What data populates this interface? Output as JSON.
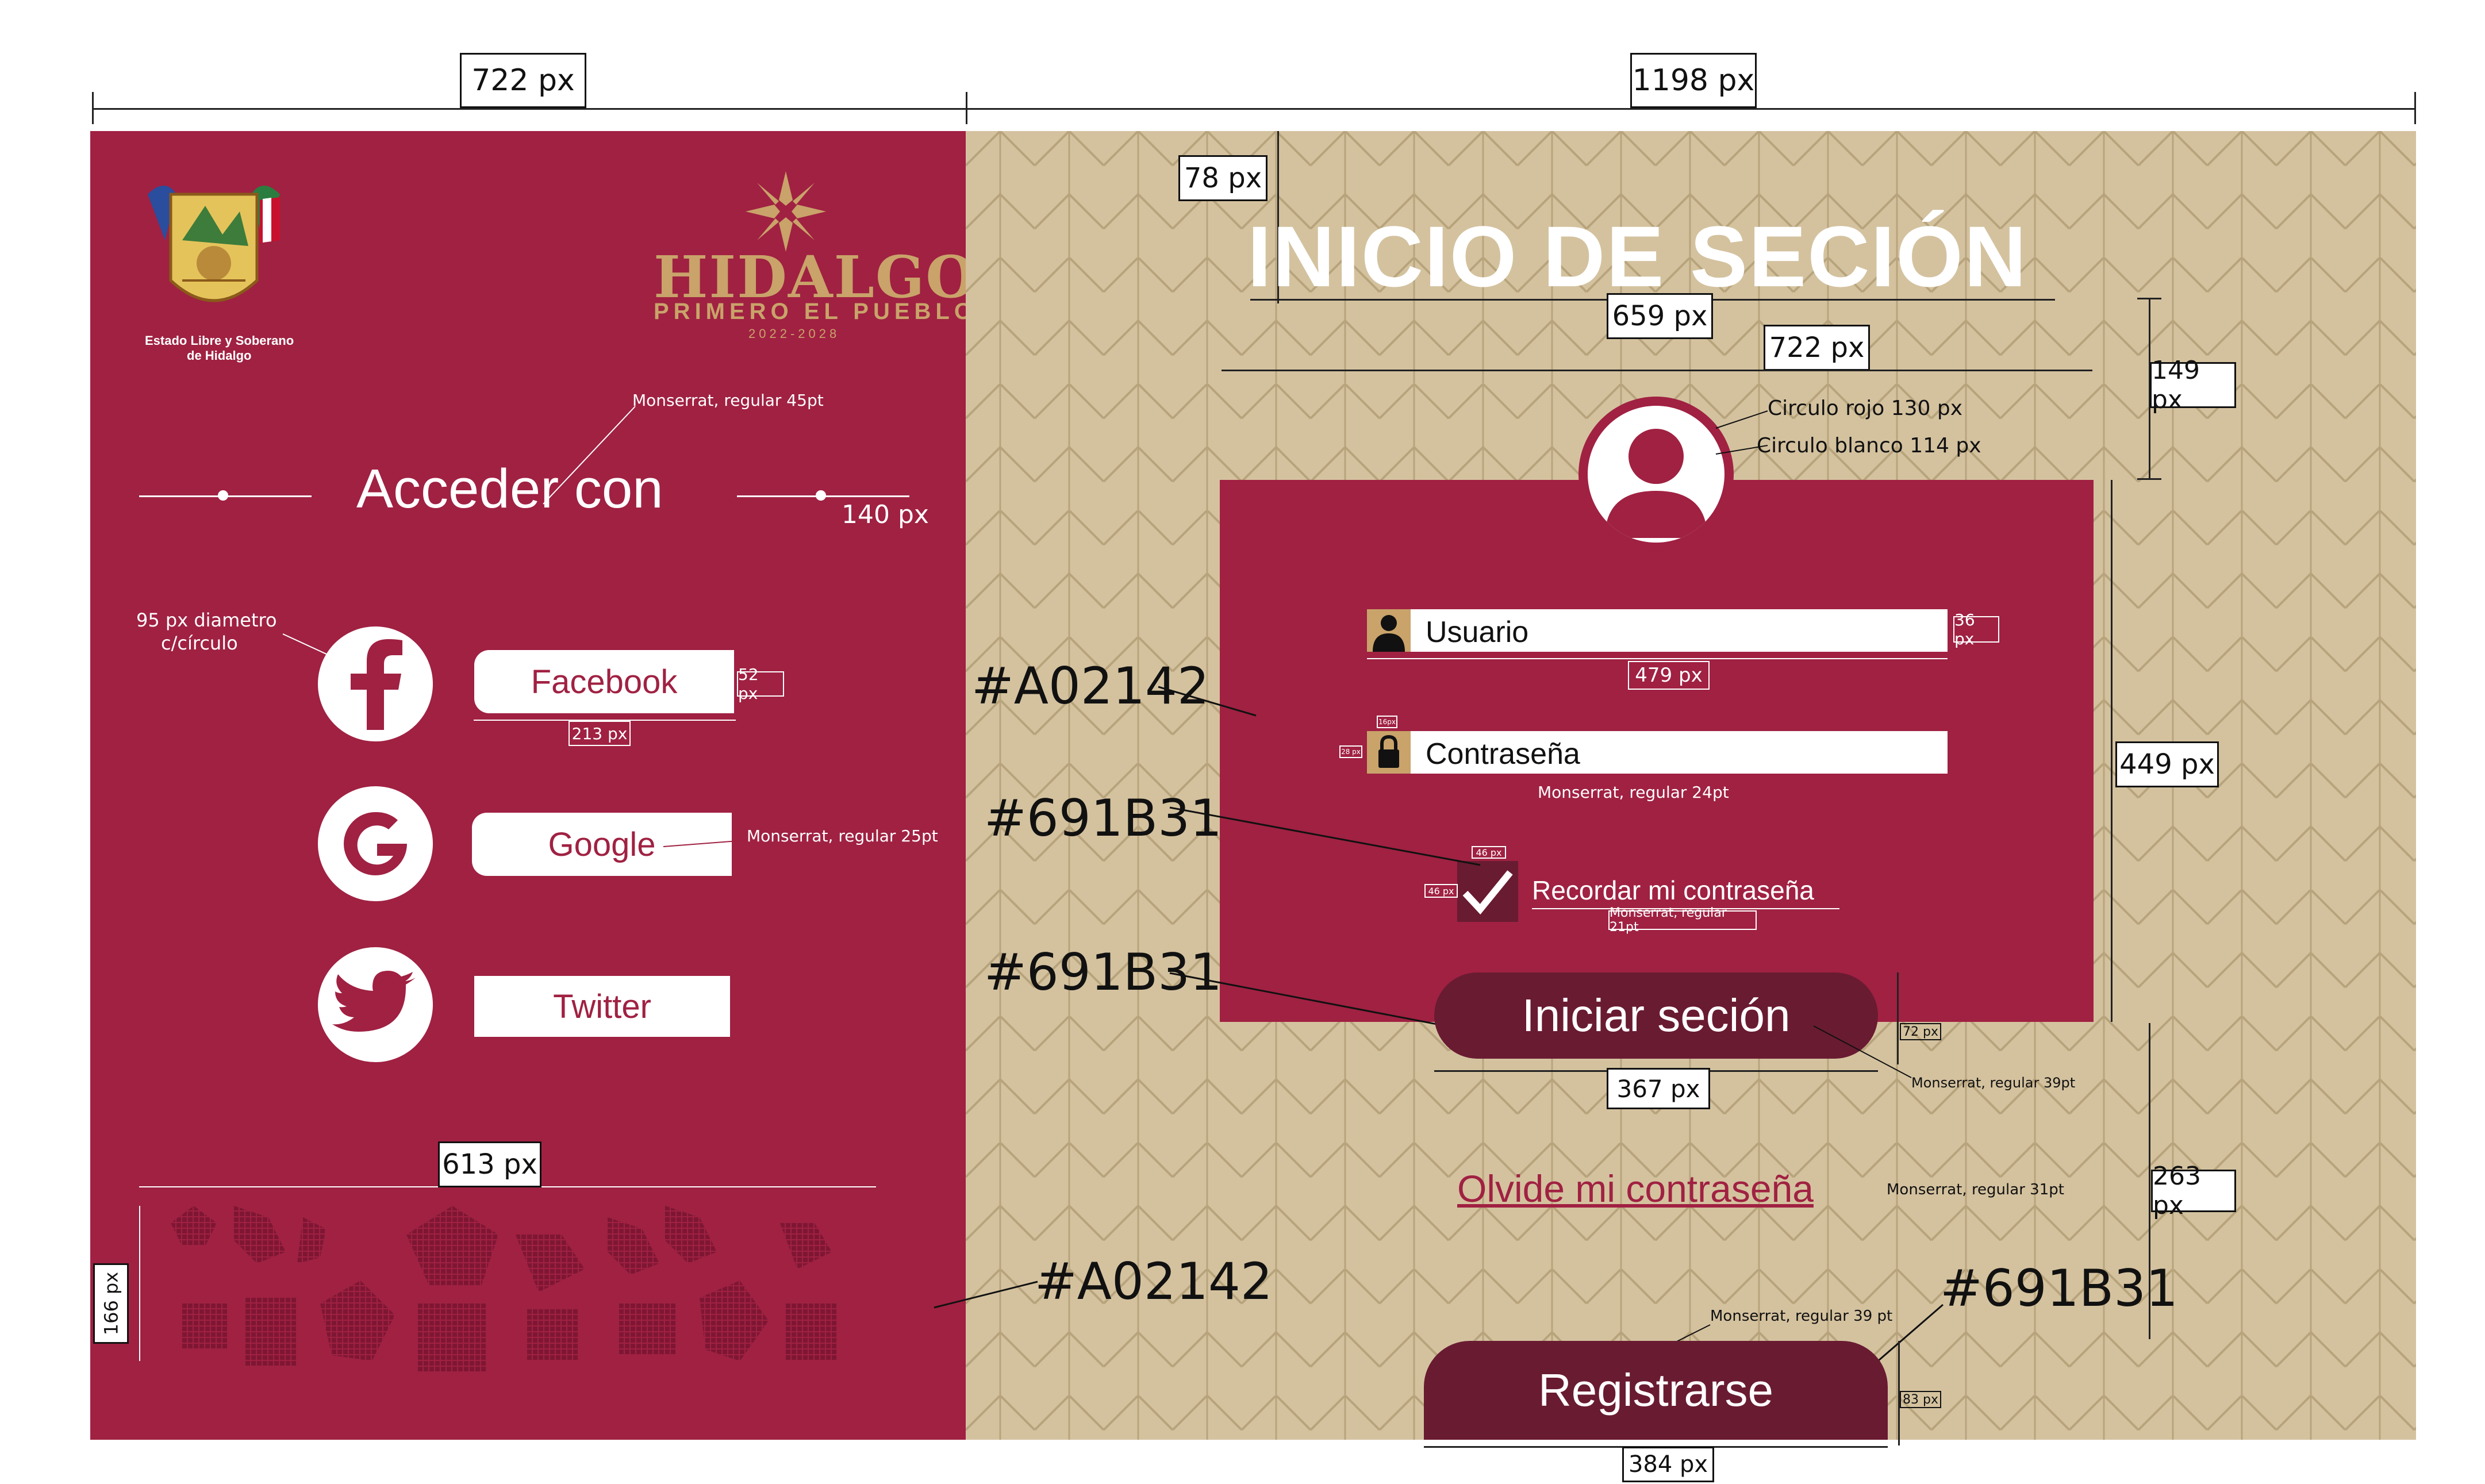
{
  "colors": {
    "primary": "#A02142",
    "dark": "#691B31",
    "beige": "#D4C29F",
    "white": "#FFFFFF"
  },
  "dimensions": {
    "left_width": "722 px",
    "right_width": "1198 px",
    "top_offset": "78 px",
    "title_width": "659 px",
    "card_width": "722 px",
    "avatar_offset": "149 px",
    "card_height": "449 px",
    "input_width": "479 px",
    "input_height": "36 px",
    "checkbox_w": "46 px",
    "checkbox_h": "46 px",
    "login_btn_width": "367 px",
    "login_btn_height": "72 px",
    "bottom_offset": "263 px",
    "register_btn_width": "384 px",
    "register_btn_height": "83 px",
    "social_label_height": "52 px",
    "social_label_width": "213 px",
    "divider_gap": "140 px",
    "pattern_width": "613 px",
    "pattern_height": "166 px",
    "tiny_box_1": "16px",
    "tiny_box_2": "28 px",
    "tiny_box_3": "16px"
  },
  "left": {
    "emblem_caption_1": "Estado Libre y Soberano",
    "emblem_caption_2": "de Hidalgo",
    "brand_name": "HIDALGO",
    "brand_tagline": "PRIMERO EL PUEBLO",
    "brand_years": "2022-2028",
    "heading": "Acceder con",
    "heading_note": "Monserrat, regular 45pt",
    "circle_note_1": "95 px diametro",
    "circle_note_2": "c/círculo",
    "social": [
      {
        "label": "Facebook",
        "icon": "facebook-icon"
      },
      {
        "label": "Google",
        "icon": "google-icon"
      },
      {
        "label": "Twitter",
        "icon": "twitter-icon"
      }
    ],
    "google_note": "Monserrat, regular 25pt",
    "pattern_hex": "#A02142"
  },
  "right": {
    "title": "INICIO DE SECIÓN",
    "avatar_note_red": "Circulo rojo 130 px",
    "avatar_note_white": "Circulo blanco 114 px",
    "card_hex": "#A02142",
    "checkbox_hex": "#691B31",
    "button_hex": "#691B31",
    "register_hex": "#691B31",
    "user_placeholder": "Usuario",
    "password_placeholder": "Contraseña",
    "password_note": "Monserrat, regular 24pt",
    "remember_label": "Recordar mi contraseña",
    "remember_note": "Monserrat, regular 21pt",
    "login_button": "Iniciar seción",
    "login_note": "Monserrat, regular 39pt",
    "forgot_link": "Olvide mi contraseña",
    "forgot_note": "Monserrat, regular 31pt",
    "register_note": "Monserrat, regular 39 pt",
    "register_button": "Registrarse"
  }
}
